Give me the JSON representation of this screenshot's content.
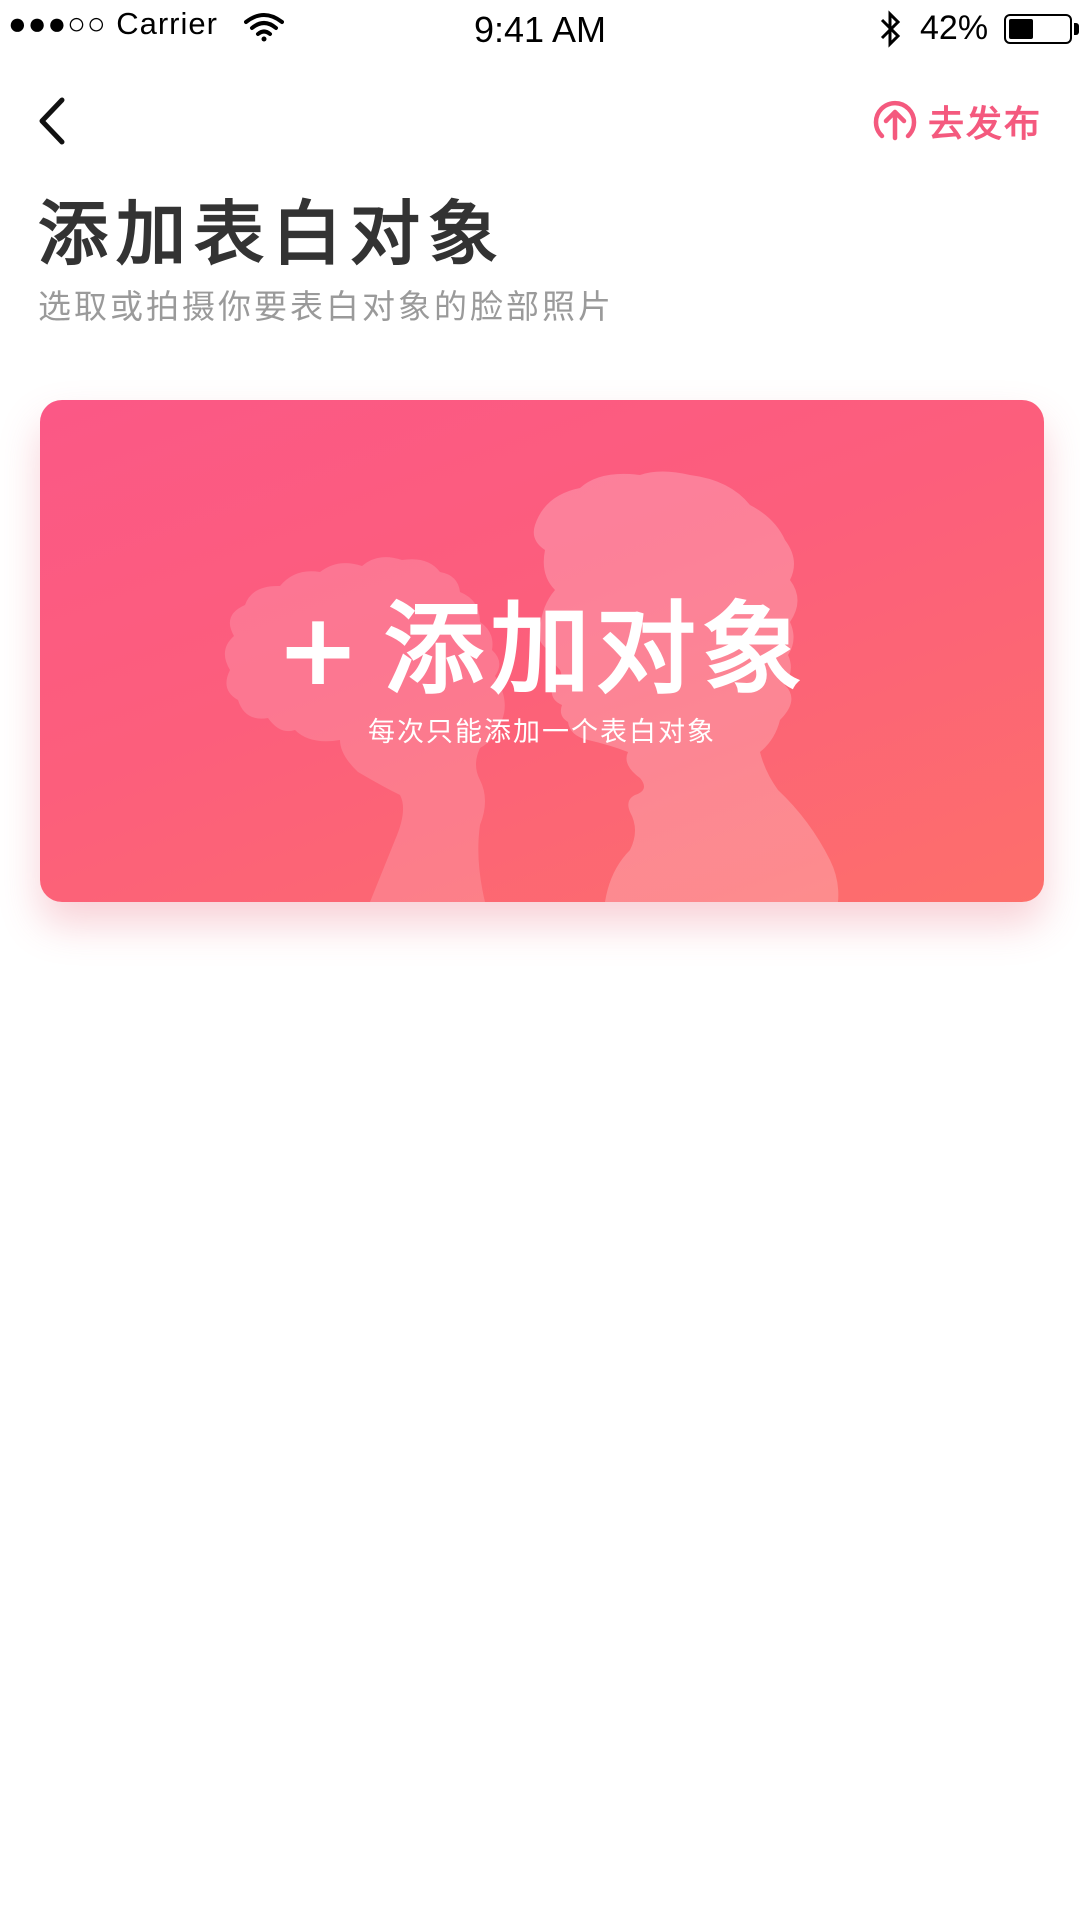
{
  "status_bar": {
    "signal": "●●●○○ Carrier",
    "time": "9:41 AM",
    "battery_percent_text": "42%",
    "battery_level": 0.42
  },
  "nav": {
    "back_icon": "chevron-left-icon",
    "publish_icon": "upload-circle-icon",
    "publish_label": "去发布"
  },
  "header": {
    "title": "添加表白对象",
    "subtitle": "选取或拍摄你要表白对象的脸部照片"
  },
  "add_card": {
    "plus": "+",
    "title": "添加对象",
    "hint": "每次只能添加一个表白对象"
  },
  "colors": {
    "accent": "#f4597e",
    "card_gradient_start": "#fb5886",
    "card_gradient_end": "#fd6f6b",
    "title_text": "#333333",
    "subtitle_text": "#9a9a9a"
  }
}
